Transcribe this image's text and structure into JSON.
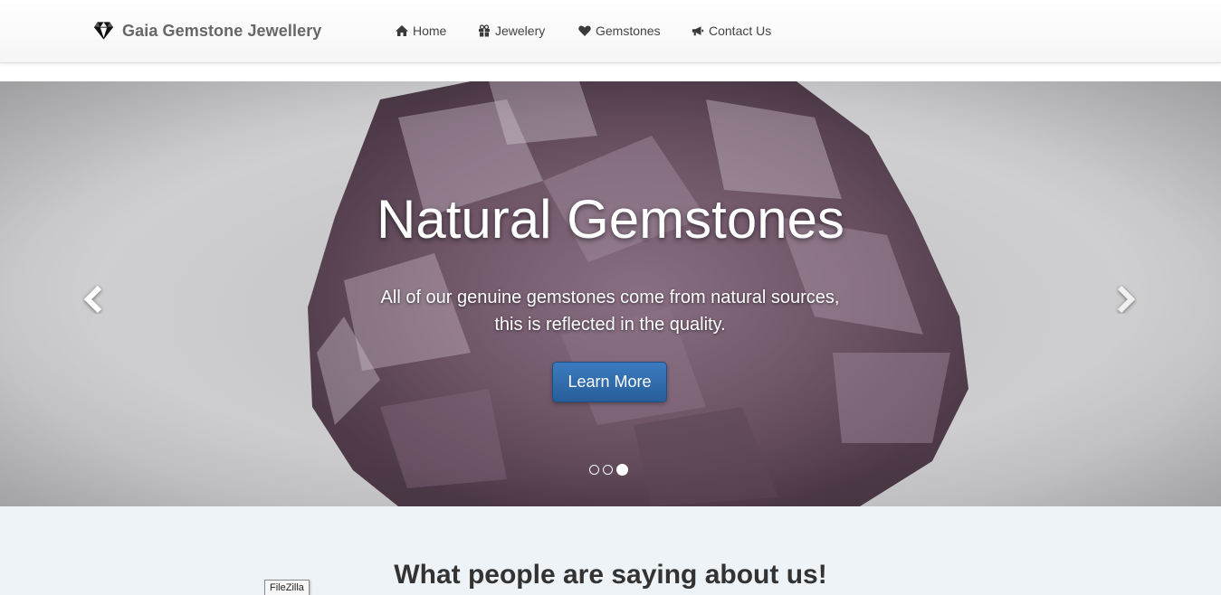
{
  "navbar": {
    "brand": "Gaia Gemstone Jewellery",
    "brand_icon": "diamond-icon",
    "items": [
      {
        "label": "Home",
        "icon": "home-icon"
      },
      {
        "label": "Jewelery",
        "icon": "gift-icon"
      },
      {
        "label": "Gemstones",
        "icon": "heart-icon"
      },
      {
        "label": "Contact Us",
        "icon": "bullhorn-icon"
      }
    ]
  },
  "carousel": {
    "title": "Natural Gemstones",
    "description_line1": "All of our genuine gemstones come from natural sources,",
    "description_line2": "this is reflected in the quality.",
    "button_label": "Learn More",
    "prev_icon": "chevron-left-icon",
    "next_icon": "chevron-right-icon",
    "slide_count": 3,
    "active_slide": 3
  },
  "testimonials": {
    "title": "What people are saying about us!"
  },
  "tooltip": {
    "text": "FileZilla"
  },
  "colors": {
    "primary_button": "#2f6ead",
    "section_background": "#eef3f7",
    "navbar_background": "#f8f8f8"
  }
}
